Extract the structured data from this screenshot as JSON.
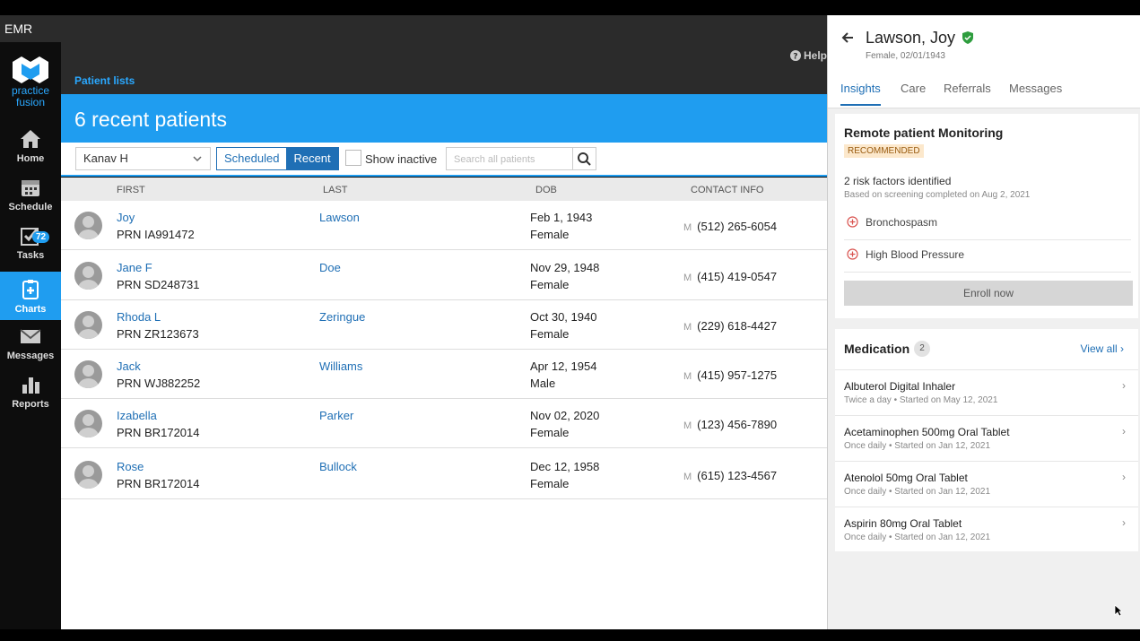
{
  "app": {
    "title": "EMR",
    "help": "Help"
  },
  "logo": {
    "line1": "practice",
    "line2": "fusion"
  },
  "nav": [
    {
      "label": "Home",
      "icon": "home-icon"
    },
    {
      "label": "Schedule",
      "icon": "calendar-icon"
    },
    {
      "label": "Tasks",
      "icon": "tasks-icon",
      "badge": "72"
    },
    {
      "label": "Charts",
      "icon": "charts-icon",
      "active": true
    },
    {
      "label": "Messages",
      "icon": "envelope-icon"
    },
    {
      "label": "Reports",
      "icon": "bar-chart-icon"
    }
  ],
  "breadcrumb": "Patient lists",
  "banner": "6 recent patients",
  "filters": {
    "provider": "Kanav H",
    "seg_scheduled": "Scheduled",
    "seg_recent": "Recent",
    "show_inactive": "Show inactive",
    "search_placeholder": "Search all patients"
  },
  "columns": {
    "first": "FIRST",
    "last": "LAST",
    "dob": "DOB",
    "contact": "CONTACT INFO"
  },
  "patients": [
    {
      "first": "Joy",
      "prn": "PRN IA991472",
      "last": "Lawson",
      "dob": "Feb 1, 1943",
      "sex": "Female",
      "m": "M",
      "phone": "(512) 265-6054"
    },
    {
      "first": "Jane F",
      "prn": "PRN SD248731",
      "last": "Doe",
      "dob": "Nov 29, 1948",
      "sex": "Female",
      "m": "M",
      "phone": "(415) 419-0547"
    },
    {
      "first": "Rhoda L",
      "prn": "PRN ZR123673",
      "last": "Zeringue",
      "dob": "Oct 30, 1940",
      "sex": "Female",
      "m": "M",
      "phone": "(229) 618-4427"
    },
    {
      "first": "Jack",
      "prn": "PRN WJ882252",
      "last": "Williams",
      "dob": "Apr 12, 1954",
      "sex": "Male",
      "m": "M",
      "phone": "(415) 957-1275"
    },
    {
      "first": "Izabella",
      "prn": "PRN BR172014",
      "last": "Parker",
      "dob": "Nov 02, 2020",
      "sex": "Female",
      "m": "M",
      "phone": "(123) 456-7890"
    },
    {
      "first": "Rose",
      "prn": "PRN BR172014",
      "last": "Bullock",
      "dob": "Dec 12, 1958",
      "sex": "Female",
      "m": "M",
      "phone": "(615) 123-4567"
    }
  ],
  "panel": {
    "name": "Lawson, Joy",
    "sub": "Female, 02/01/1943",
    "tabs": [
      "Insights",
      "Care",
      "Referrals",
      "Messages"
    ],
    "rpm": {
      "title": "Remote patient Monitoring",
      "badge": "RECOMMENDED",
      "risk_count": "2 risk factors identified",
      "risk_sub": "Based on screening completed on Aug 2, 2021",
      "risks": [
        "Bronchospasm",
        "High Blood Pressure"
      ],
      "enroll": "Enroll now"
    },
    "medication": {
      "title": "Medication",
      "count": "2",
      "view_all": "View all",
      "items": [
        {
          "name": "Albuterol Digital Inhaler",
          "sig": "Twice a day • Started on May 12, 2021"
        },
        {
          "name": "Acetaminophen 500mg Oral Tablet",
          "sig": "Once daily • Started on Jan 12, 2021"
        },
        {
          "name": "Atenolol 50mg Oral Tablet",
          "sig": "Once daily • Started on Jan 12, 2021"
        },
        {
          "name": "Aspirin 80mg Oral Tablet",
          "sig": "Once daily • Started on Jan 12, 2021"
        }
      ]
    }
  },
  "colors": {
    "accent": "#1f9df0",
    "link": "#1f6fb5",
    "sidebar": "#0d0d0d",
    "recommended_bg": "#fce8cc"
  }
}
